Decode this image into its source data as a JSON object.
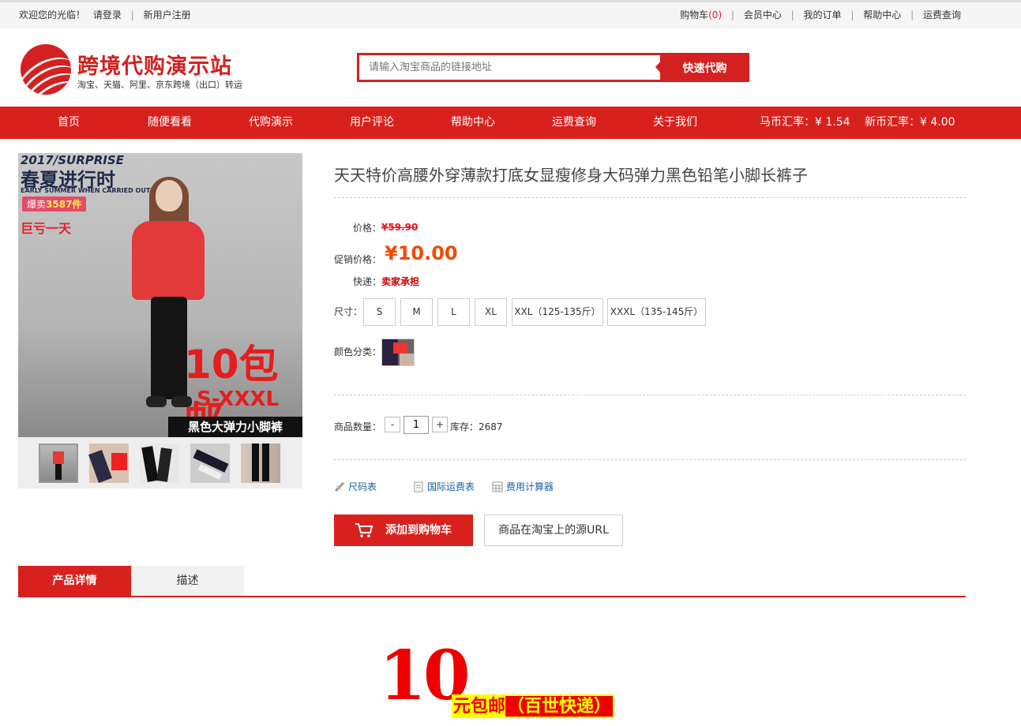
{
  "topbar": {
    "welcome": "欢迎您的光临！",
    "login": "请登录",
    "register": "新用户注册",
    "cart_label": "购物车",
    "cart_count": "(0)",
    "member": "会员中心",
    "orders": "我的订单",
    "help": "帮助中心",
    "shipping_query": "运费查询"
  },
  "header": {
    "logo_title": "跨境代购演示站",
    "logo_subtitle": "淘宝、天猫、阿里、京东跨境（出口）转运",
    "search_placeholder": "请输入淘宝商品的链接地址",
    "search_button": "快速代购"
  },
  "nav": {
    "items": [
      "首页",
      "随便看看",
      "代购演示",
      "用户评论",
      "帮助中心",
      "运费查询",
      "关于我们"
    ],
    "rate_mb": "马币汇率：¥ 1.54",
    "rate_sg": "新币汇率：¥ 4.00"
  },
  "gallery": {
    "main_image": {
      "line1": "2017/SURPRISE",
      "line2": "春夏进行时",
      "line3": "EARLY SUMMER WHEN CARRIED OUT",
      "sold_prefix": "爆卖",
      "sold_count": "3587件",
      "promo": "巨亏一天",
      "big": "10包邮",
      "sizes": "S-XXXL",
      "caption": "黑色大弹力小脚裤"
    },
    "thumb_count": 5
  },
  "product": {
    "title": "天天特价高腰外穿薄款打底女显瘦修身大码弹力黑色铅笔小脚长裤子",
    "price_label": "价格：",
    "price_original": "¥59.90",
    "promo_label": "促销价格：",
    "promo_price": "¥10.00",
    "shipping_label": "快递：",
    "shipping_value": "卖家承担",
    "size_label": "尺寸：",
    "sizes": [
      "S",
      "M",
      "L",
      "XL",
      "XXL（125-135斤）",
      "XXXL（135-145斤）"
    ],
    "color_label": "颜色分类：",
    "qty_label": "商品数量：",
    "qty_minus": "-",
    "qty_value": "1",
    "qty_plus": "+",
    "stock": "库存：2687",
    "tools": [
      "尺码表",
      "国际运费表",
      "费用计算器"
    ],
    "add_to_cart": "添加到购物车",
    "source_url": "商品在淘宝上的源URL"
  },
  "tabs": [
    "产品详情",
    "描述"
  ],
  "detail_banner": {
    "number": "10",
    "text": "元包邮",
    "highlight": "（百世快递）"
  },
  "colors": {
    "brand_red": "#d8211d",
    "price_orange": "#f24b00",
    "link_blue": "#1a5fa8"
  }
}
